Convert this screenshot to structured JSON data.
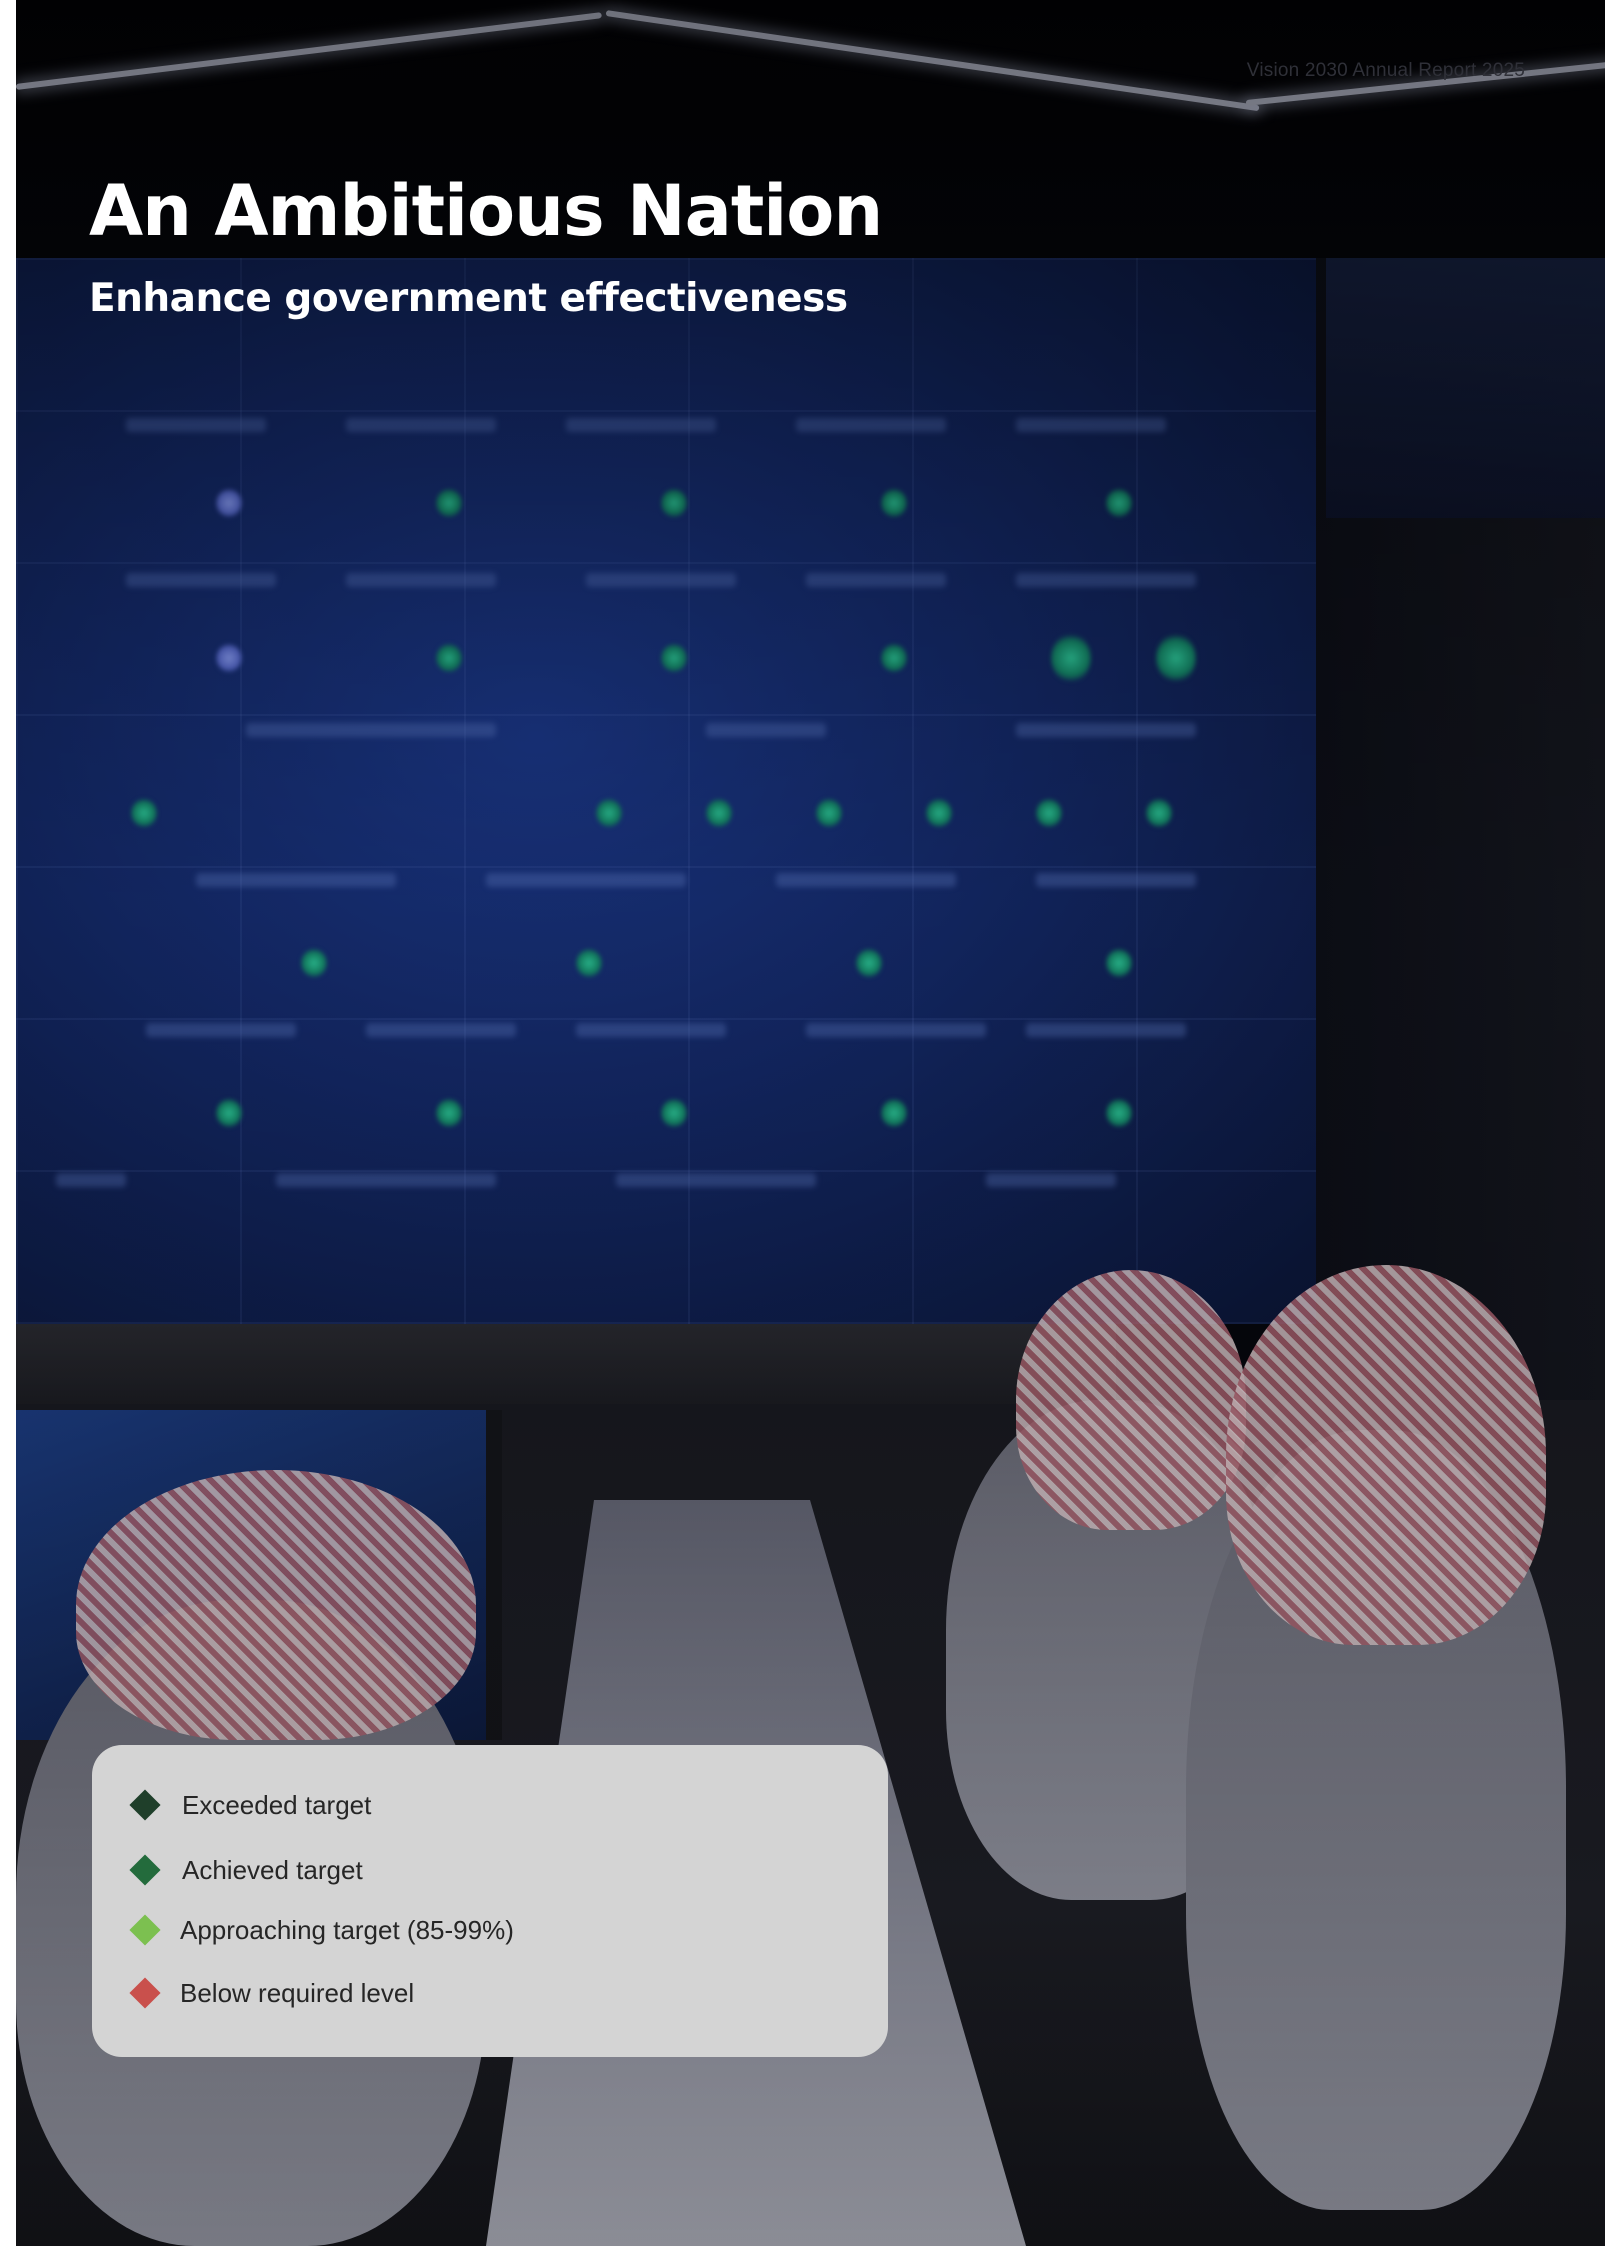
{
  "header": {
    "report_label": "Vision 2030 Annual Report 2025"
  },
  "title": "An Ambitious Nation",
  "subtitle": "Enhance government effectiveness",
  "legend": {
    "items": [
      {
        "label": "Exceeded target",
        "color": "#1f3f2a"
      },
      {
        "label": "Achieved target",
        "color": "#236b3c"
      },
      {
        "label": "Approaching target (85-99%)",
        "color": "#7cc050"
      },
      {
        "label": "Below required level",
        "color": "#c9504c"
      }
    ]
  }
}
